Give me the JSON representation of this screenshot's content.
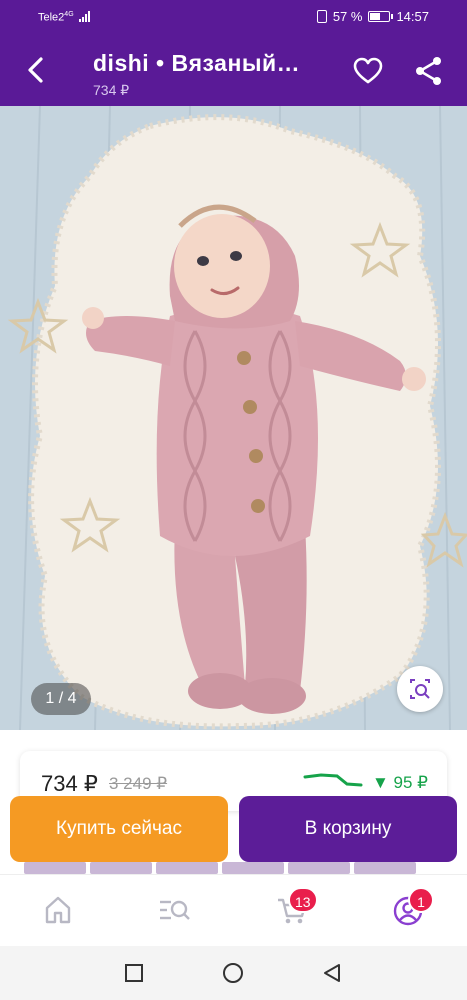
{
  "status_bar": {
    "carrier": "Tele2",
    "network": "4G",
    "battery": "57 %",
    "battery_level": 0.57,
    "time": "14:57"
  },
  "header": {
    "title": "dishi  •  Вязаный…",
    "price": "734 ₽",
    "icons": [
      "back-arrow-icon",
      "heart-icon",
      "share-icon"
    ]
  },
  "gallery": {
    "counter": "1 / 4",
    "current": 1,
    "total": 4
  },
  "price_card": {
    "price": "734 ₽",
    "old_price": "3 249 ₽",
    "drop": "▼ 95 ₽"
  },
  "actions": {
    "buy_now": "Купить сейчас",
    "add_to_cart": "В корзину"
  },
  "tab_bar": {
    "items": [
      {
        "icon": "home-icon"
      },
      {
        "icon": "catalog-search-icon"
      },
      {
        "icon": "cart-icon",
        "badge": "13"
      },
      {
        "icon": "profile-icon",
        "badge": "1"
      }
    ]
  },
  "colors": {
    "brand": "#5a1a97",
    "buy": "#f59a23",
    "cart": "#5c1d98",
    "badge": "#e91e4c",
    "drop": "#16a34a"
  }
}
